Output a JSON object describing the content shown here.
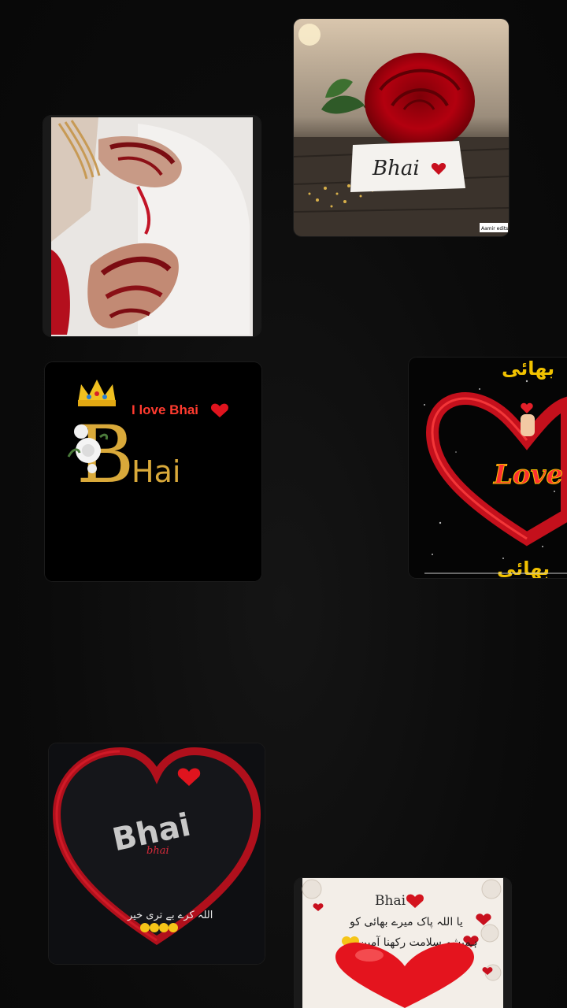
{
  "cards": {
    "henna": {
      "caption": ""
    },
    "rose": {
      "note_text": "Bhai",
      "watermark": "Aamir edits"
    },
    "bhai_letter": {
      "love_line": "I love Bhai",
      "big_letter": "B",
      "rest_word": "Hai"
    },
    "love_heart": {
      "top_urdu": "بھائی",
      "love_word": "Love",
      "bottom_urdu": "بھائی"
    },
    "bhai_heart": {
      "main_word": "Bhai",
      "sub_word": "bhai",
      "urdu_line": "اللہ کرے بے تری خیر"
    },
    "dua": {
      "title": "Bhai",
      "line1": "یا اللہ پاک میرے بھائی کو",
      "line2": "ہمیشہ سلامت رکھنا آمین"
    }
  },
  "colors": {
    "background": "#0b0b0b",
    "accent_red": "#c8101e",
    "gold": "#e0b84c"
  }
}
